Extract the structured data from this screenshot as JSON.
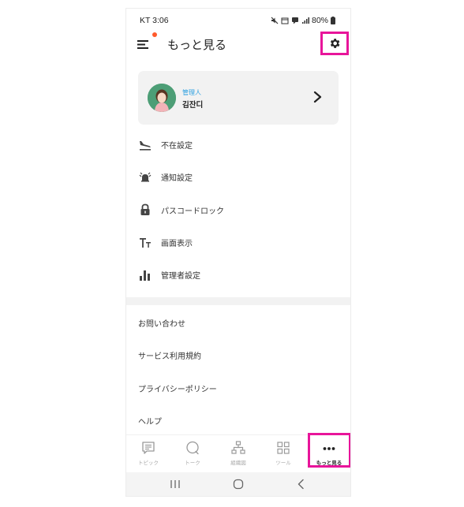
{
  "status_bar": {
    "time": "KT 3:06",
    "battery": "80%"
  },
  "header": {
    "title": "もっと見る"
  },
  "profile": {
    "role": "管理人",
    "name": "김잔디"
  },
  "menu": {
    "items": [
      {
        "label": "不在設定",
        "icon": "airplane-landing-icon"
      },
      {
        "label": "通知設定",
        "icon": "bell-ringing-icon"
      },
      {
        "label": "パスコードロック",
        "icon": "lock-icon"
      },
      {
        "label": "画面表示",
        "icon": "text-size-icon"
      },
      {
        "label": "管理者設定",
        "icon": "bar-chart-icon"
      }
    ]
  },
  "links": {
    "items": [
      {
        "label": "お問い合わせ"
      },
      {
        "label": "サービス利用規約"
      },
      {
        "label": "プライバシーポリシー"
      },
      {
        "label": "ヘルプ"
      }
    ]
  },
  "bottom_nav": {
    "items": [
      {
        "label": "トピック",
        "icon": "topic-icon"
      },
      {
        "label": "トーク",
        "icon": "talk-icon"
      },
      {
        "label": "組織図",
        "icon": "org-chart-icon"
      },
      {
        "label": "ツール",
        "icon": "grid-icon"
      },
      {
        "label": "もっと見る",
        "icon": "more-dots-icon"
      }
    ],
    "active_index": 4
  },
  "colors": {
    "highlight": "#e8159a",
    "accent_blue": "#2b9fe0",
    "notification_dot": "#ff5a2c"
  }
}
